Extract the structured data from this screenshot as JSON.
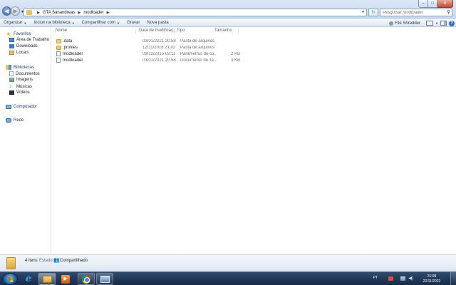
{
  "address_bar": {
    "crumbs": [
      "GTA Sanandreas",
      "modloader"
    ],
    "search_placeholder": "Pesquisar modloader"
  },
  "command_bar": {
    "items": [
      {
        "label": "Organizar",
        "dropdown": true
      },
      {
        "label": "Incluir na biblioteca",
        "dropdown": true
      },
      {
        "label": "Compartilhar com",
        "dropdown": true
      },
      {
        "label": "Gravar",
        "dropdown": false
      },
      {
        "label": "Nova pasta",
        "dropdown": false
      }
    ],
    "file_shredder_label": "File Shredder"
  },
  "nav_pane": {
    "favorites": {
      "label": "Favoritos",
      "items": [
        "Área de Trabalho",
        "Downloads",
        "Locais"
      ]
    },
    "libraries": {
      "label": "Bibliotecas",
      "items": [
        "Documentos",
        "Imagens",
        "Músicas",
        "Vídeos"
      ]
    },
    "computer": "Computador",
    "network": "Rede"
  },
  "file_list": {
    "columns": [
      "Nome",
      "Data de modificaç...",
      "Tipo",
      "Tamanho"
    ],
    "rows": [
      {
        "name": ".data",
        "date": "03/01/2021 20:58",
        "type": "Pasta de arquivos",
        "size": "",
        "icon": "folder-icon"
      },
      {
        "name": ".profiles",
        "date": "12/11/2016 21:02",
        "type": "Pasta de arquivos",
        "size": "",
        "icon": "folder-icon"
      },
      {
        "name": "modloader",
        "date": "09/12/2015 02:11",
        "type": "Parâmetros de co...",
        "size": "2 KB",
        "icon": "config-file-icon"
      },
      {
        "name": "modloader",
        "date": "03/01/2021 20:58",
        "type": "Documento de Te...",
        "size": "3 KB",
        "icon": "text-file-icon"
      }
    ]
  },
  "details_pane": {
    "count": "4 itens",
    "state_label": "Estado:",
    "state_value": "Compartilhado"
  },
  "taskbar": {
    "apps": [
      "internet-explorer-icon",
      "windows-explorer-icon",
      "media-player-icon",
      "chrome-icon",
      "window-app-icon"
    ],
    "tray": {
      "language": "PT",
      "time": "21:08",
      "date": "22/11/2022"
    }
  }
}
